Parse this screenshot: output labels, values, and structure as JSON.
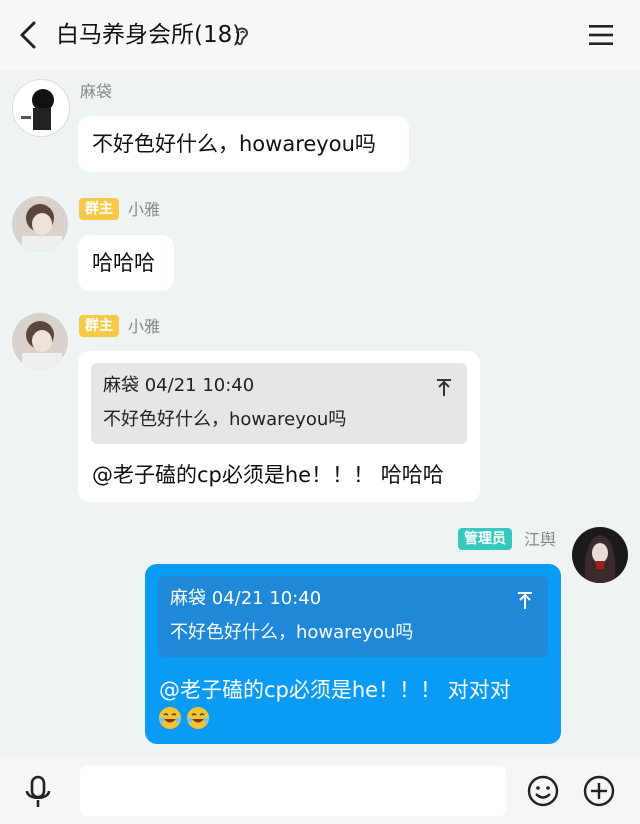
{
  "header": {
    "title": "白马养身会所(18)",
    "back_icon": "back-arrow-icon",
    "ear_icon": "ear-icon",
    "menu_icon": "menu-icon"
  },
  "messages": [
    {
      "sender": "麻袋",
      "text": "不好色好什么，howareyou吗"
    },
    {
      "sender": "小雅",
      "badge": "群主",
      "text": "哈哈哈"
    },
    {
      "sender": "小雅",
      "badge": "群主",
      "quote": {
        "author_time": "麻袋 04/21 10:40",
        "text": "不好色好什么，howareyou吗"
      },
      "text": "@老子磕的cp必须是he！！！ 哈哈哈"
    },
    {
      "sender": "江舆",
      "badge": "管理员",
      "quote": {
        "author_time": "麻袋 04/21 10:40",
        "text": "不好色好什么，howareyou吗"
      },
      "text": "@老子磕的cp必须是he！！！ 对对对"
    }
  ],
  "colors": {
    "self_bubble": "#0a9bf5",
    "owner_badge": "#f7c948",
    "admin_badge": "#37c8c0",
    "background": "#eef3f4"
  },
  "input": {
    "placeholder": ""
  }
}
